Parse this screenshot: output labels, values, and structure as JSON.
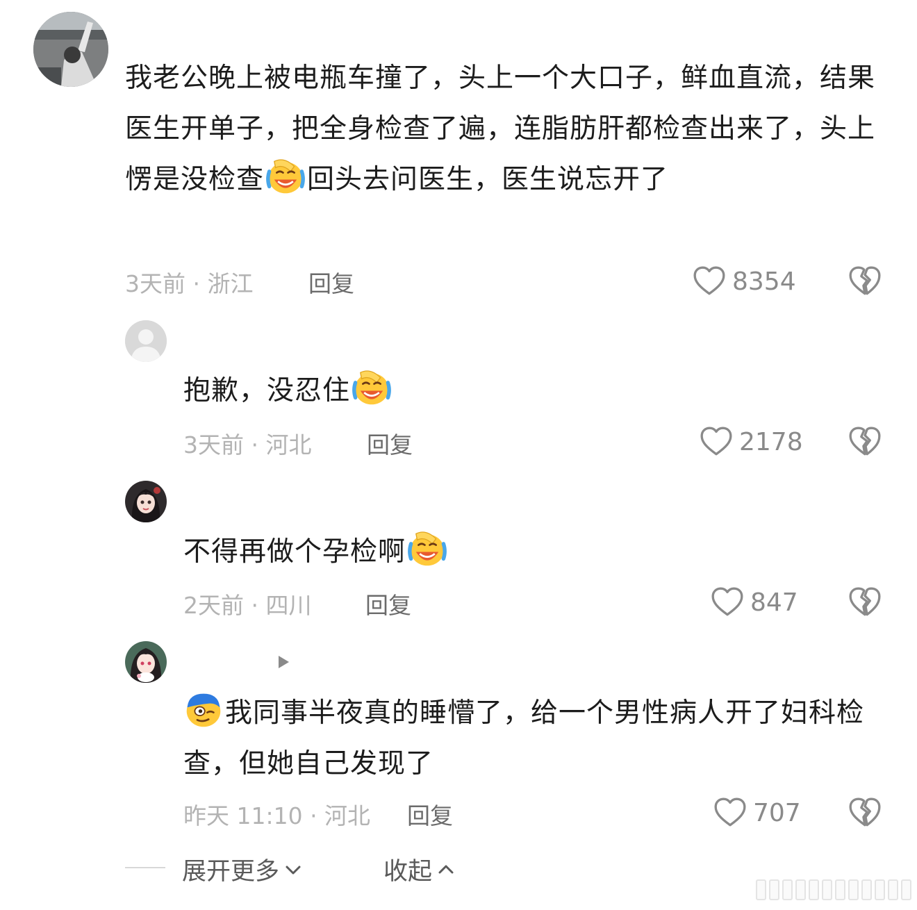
{
  "comments": [
    {
      "text_parts": [
        "我老公晚上被电瓶车撞了，头上一个大口子，鲜血直流，结果医生开单子，把全身检查了遍，连脂肪肝都检查出来了，头上愣是没检查",
        "回头去问医生，医生说忘开了"
      ],
      "meta": "3天前 · 浙江",
      "reply": "回复",
      "likes": "8354"
    },
    {
      "text_parts": [
        "抱歉，没忍住"
      ],
      "meta": "3天前 · 河北",
      "reply": "回复",
      "likes": "2178"
    },
    {
      "text_parts": [
        "不得再做个孕检啊"
      ],
      "meta": "2天前 · 四川",
      "reply": "回复",
      "likes": "847"
    },
    {
      "text_parts": [
        "我同事半夜真的睡懵了，给一个男性病人开了妇科检查，但她自己发现了"
      ],
      "meta": "昨天 11:10 · 河北",
      "reply": "回复",
      "likes": "707"
    }
  ],
  "footer": {
    "expand_label": "展开更多",
    "collapse_label": "收起"
  },
  "icons": {
    "like": "heart-icon",
    "dislike": "broken-heart-icon",
    "laugh_emoji": "laugh-cry-emoji-icon",
    "sleep_emoji": "sleepy-emoji-icon",
    "play": "play-triangle-icon"
  },
  "colors": {
    "text": "#1c1c1c",
    "meta": "#b3b3b3",
    "reply": "#6b6b6b",
    "count": "#8a8a8a"
  }
}
